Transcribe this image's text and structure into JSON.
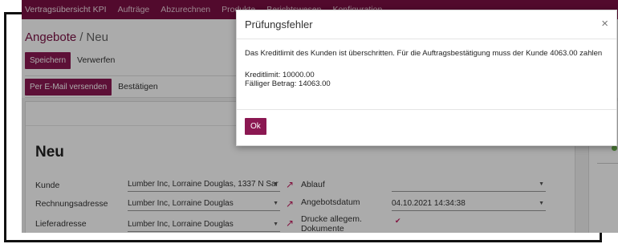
{
  "nav": {
    "items": [
      "Vertragsübersicht KPI",
      "Aufträge",
      "Abzurechnen",
      "Produkte",
      "Berichtswesen",
      "Konfiguration"
    ]
  },
  "breadcrumb": {
    "parent": "Angebote",
    "separator": "/",
    "current": "Neu"
  },
  "toolbar": {
    "save_label": "Speichern",
    "discard_label": "Verwerfen"
  },
  "status_bar": {
    "email_label": "Per E-Mail versenden",
    "confirm_label": "Bestätigen"
  },
  "form": {
    "title": "Neu",
    "fields": [
      {
        "label": "Kunde",
        "value": "Lumber Inc, Lorraine Douglas, 1337 N Sar"
      },
      {
        "label": "Rechnungsadresse",
        "value": "Lumber Inc, Lorraine Douglas"
      },
      {
        "label": "Lieferadresse",
        "value": "Lumber Inc, Lorraine Douglas"
      }
    ],
    "right_fields": [
      {
        "label": "Ablauf",
        "value": ""
      },
      {
        "label": "Angebotsdatum",
        "value": "04.10.2021 14:34:38"
      },
      {
        "label": "Drucke allegem. Dokumente",
        "value": "✔"
      }
    ]
  },
  "dialog": {
    "title": "Prüfungsfehler",
    "close_symbol": "×",
    "message": "Das Kreditlimit des Kunden ist überschritten. Für die Auftragsbestätigung muss der Kunde 4063.00 zahlen",
    "credit_limit": "Kreditlimit:  10000.00",
    "due_amount": "Fälliger Betrag: 14063.00",
    "ok_label": "Ok"
  },
  "colors": {
    "brand": "#7b0f44",
    "button": "#8b1852",
    "link_icon": "#c0185c"
  }
}
